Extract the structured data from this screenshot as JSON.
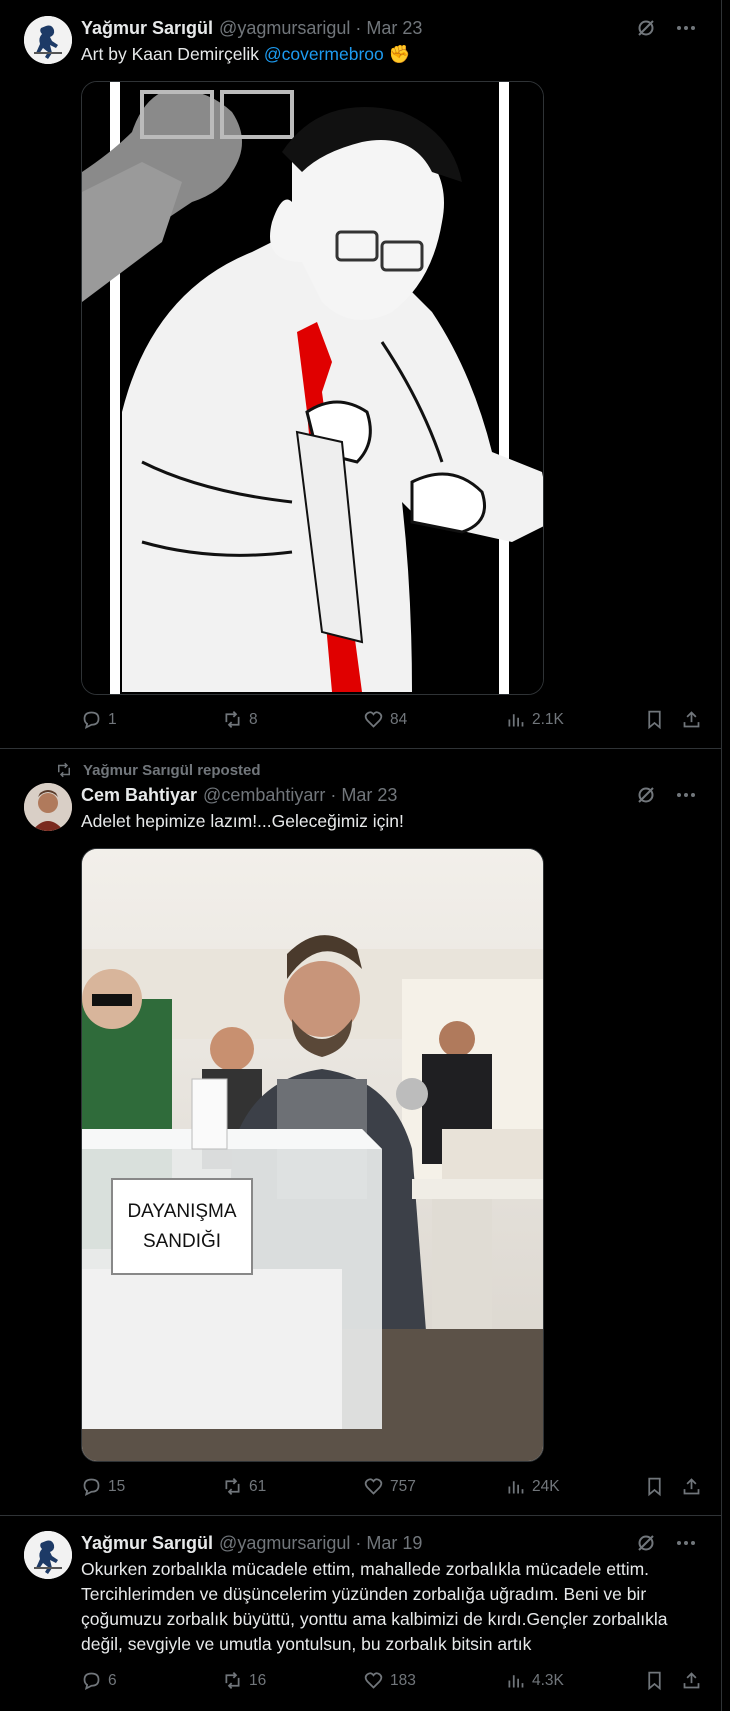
{
  "tweets": [
    {
      "author_name": "Yağmur Sarıgül",
      "handle": "@yagmursarigul",
      "date": "Mar 23",
      "text_prefix": "Art by Kaan Demirçelik ",
      "mention": "@covermebroo",
      "emoji": "✊",
      "media_description": "illustration",
      "replies": "1",
      "reposts": "8",
      "likes": "84",
      "views": "2.1K"
    },
    {
      "repost_label": "Yağmur Sarıgül reposted",
      "author_name": "Cem Bahtiyar",
      "handle": "@cembahtiyarr",
      "date": "Mar 23",
      "text": "Adelet hepimize lazım!...Geleceğimiz için!",
      "ballot_sign_line1": "DAYANIŞMA",
      "ballot_sign_line2": "SANDIĞI",
      "replies": "15",
      "reposts": "61",
      "likes": "757",
      "views": "24K"
    },
    {
      "author_name": "Yağmur Sarıgül",
      "handle": "@yagmursarigul",
      "date": "Mar 19",
      "text": "Okurken zorbalıkla mücadele ettim, mahallede zorbalıkla mücadele ettim. Tercihlerimden ve düşüncelerim yüzünden zorbalığa uğradım. Beni ve bir çoğumuzu zorbalık büyüttü, yonttu ama kalbimizi de kırdı.Gençler zorbalıkla değil, sevgiyle ve umutla yontulsun, bu zorbalık bitsin artık",
      "replies": "6",
      "reposts": "16",
      "likes": "183",
      "views": "4.3K"
    }
  ],
  "colors": {
    "background": "#000000",
    "text": "#e7e9ea",
    "muted": "#71767b",
    "link": "#1d9bf0",
    "divider": "#2f3336"
  }
}
